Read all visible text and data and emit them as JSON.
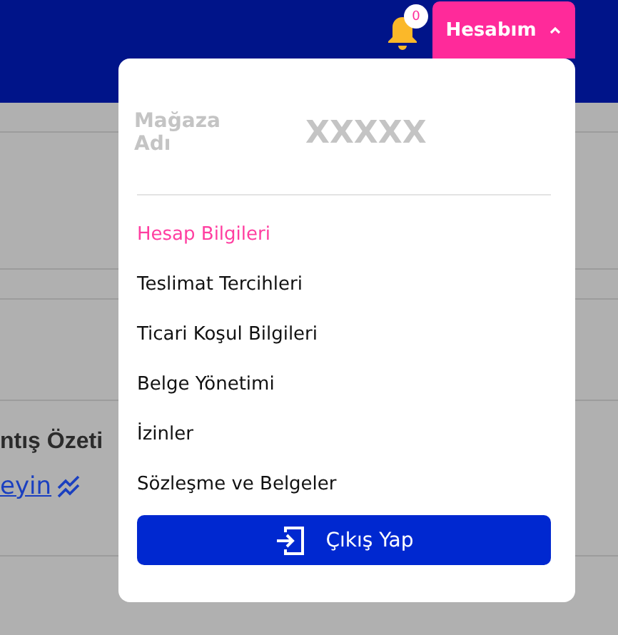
{
  "header": {
    "notification_count": "0",
    "account_button": {
      "label": "Hesabım",
      "expanded": true
    }
  },
  "background": {
    "heading": "ntış Özeti",
    "link": "eyin"
  },
  "dropdown": {
    "store_label": "Mağaza Adı",
    "store_name": "XXXXX",
    "items": [
      {
        "label": "Hesap Bilgileri",
        "selected": true
      },
      {
        "label": "Teslimat Tercihleri",
        "selected": false
      },
      {
        "label": "Ticari Koşul Bilgileri",
        "selected": false
      },
      {
        "label": "Belge Yönetimi",
        "selected": false
      },
      {
        "label": "İzinler",
        "selected": false
      },
      {
        "label": "Sözleşme ve Belgeler",
        "selected": false
      }
    ],
    "logout": "Çıkış Yap"
  }
}
